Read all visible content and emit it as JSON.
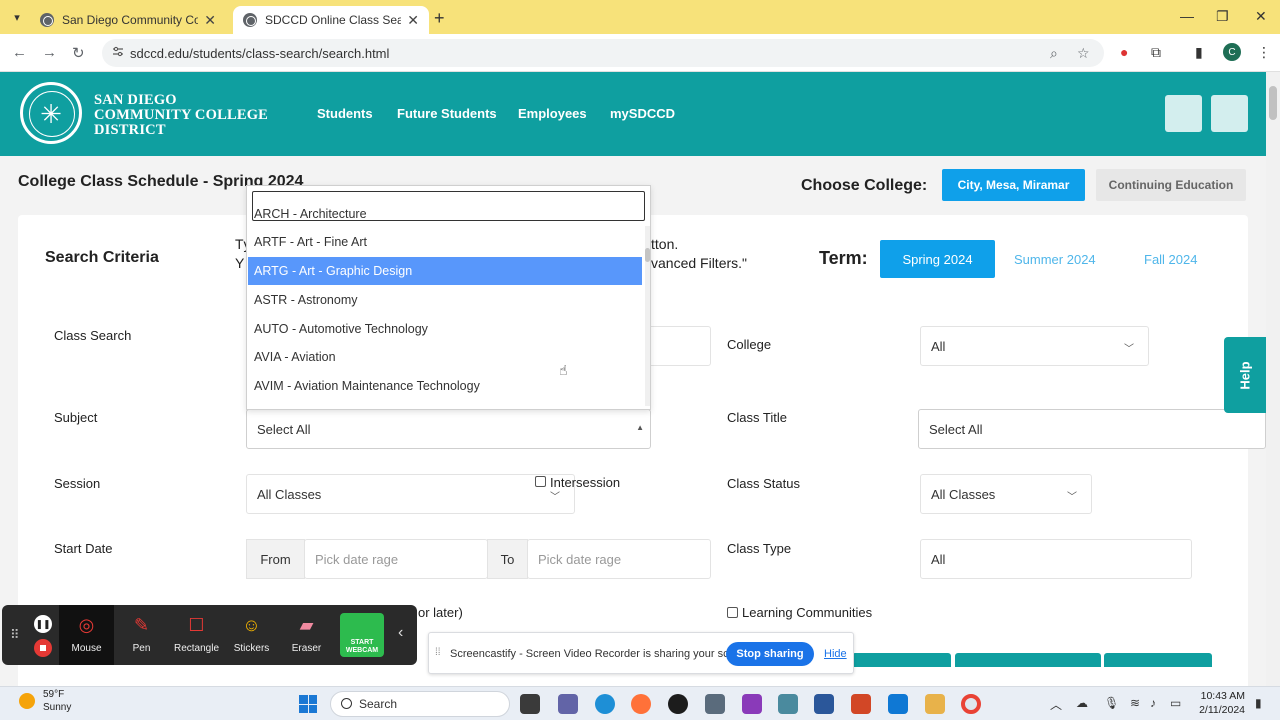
{
  "browser": {
    "tabs": [
      {
        "title": "San Diego Community College"
      },
      {
        "title": "SDCCD Online Class Search"
      }
    ],
    "url": "sdccd.edu/students/class-search/search.html",
    "profile_initial": "C"
  },
  "site": {
    "logo_lines": [
      "SAN DIEGO",
      "COMMUNITY COLLEGE",
      "DISTRICT"
    ],
    "nav": [
      "Students",
      "Future Students",
      "Employees",
      "mySDCCD"
    ]
  },
  "page": {
    "title": "College Class Schedule - Spring 2024",
    "choose_college_label": "Choose College:",
    "college_buttons": [
      "City, Mesa, Miramar",
      "Continuing Education"
    ],
    "search_criteria": "Search Criteria",
    "helper_left_1": "Tу",
    "helper_left_2": "Y",
    "helper_right_1": "tton.",
    "helper_right_2": "vanced Filters.\"",
    "term_label": "Term:",
    "terms": [
      "Spring 2024",
      "Summer 2024",
      "Fall 2024"
    ],
    "help": "Help"
  },
  "form": {
    "class_search_label": "Class Search",
    "college_label": "College",
    "college_value": "All",
    "subject_label": "Subject",
    "subject_value": "Select All",
    "class_title_label": "Class Title",
    "class_title_value": "Select All",
    "session_label": "Session",
    "session_value": "All Classes",
    "intersession_label": "Intersession",
    "class_status_label": "Class Status",
    "class_status_value": "All Classes",
    "start_date_label": "Start Date",
    "from_label": "From",
    "from_placeholder": "Pick date rage",
    "to_label": "To",
    "to_placeholder": "Pick date rage",
    "class_type_label": "Class Type",
    "class_type_value": "All",
    "partial_text": "or later)",
    "learning_communities_label": "Learning Communities"
  },
  "subject_dropdown": {
    "items": [
      "ARCH - Architecture",
      "ARTF - Art - Fine Art",
      "ARTG - Art - Graphic Design",
      "ASTR - Astronomy",
      "AUTO - Automotive Technology",
      "AVIA - Aviation",
      "AVIM - Aviation Maintenance Technology"
    ],
    "highlighted_index": 2
  },
  "screencastify": {
    "tools": [
      "Mouse",
      "Pen",
      "Rectangle",
      "Stickers",
      "Eraser"
    ],
    "webcam_label_1": "START",
    "webcam_label_2": "WEBCAM",
    "share_text": "Screencastify - Screen Video Recorder is sharing your screen.",
    "stop_sharing": "Stop sharing",
    "hide": "Hide"
  },
  "taskbar": {
    "weather_temp": "59°F",
    "weather_desc": "Sunny",
    "search_label": "Search",
    "time": "10:43 AM",
    "date": "2/11/2024"
  },
  "colors": {
    "brand_teal": "#0f9fa0",
    "accent_blue": "#0fa0ea",
    "highlight_blue": "#5897fb",
    "browser_tab_yellow": "#f7e27a"
  }
}
